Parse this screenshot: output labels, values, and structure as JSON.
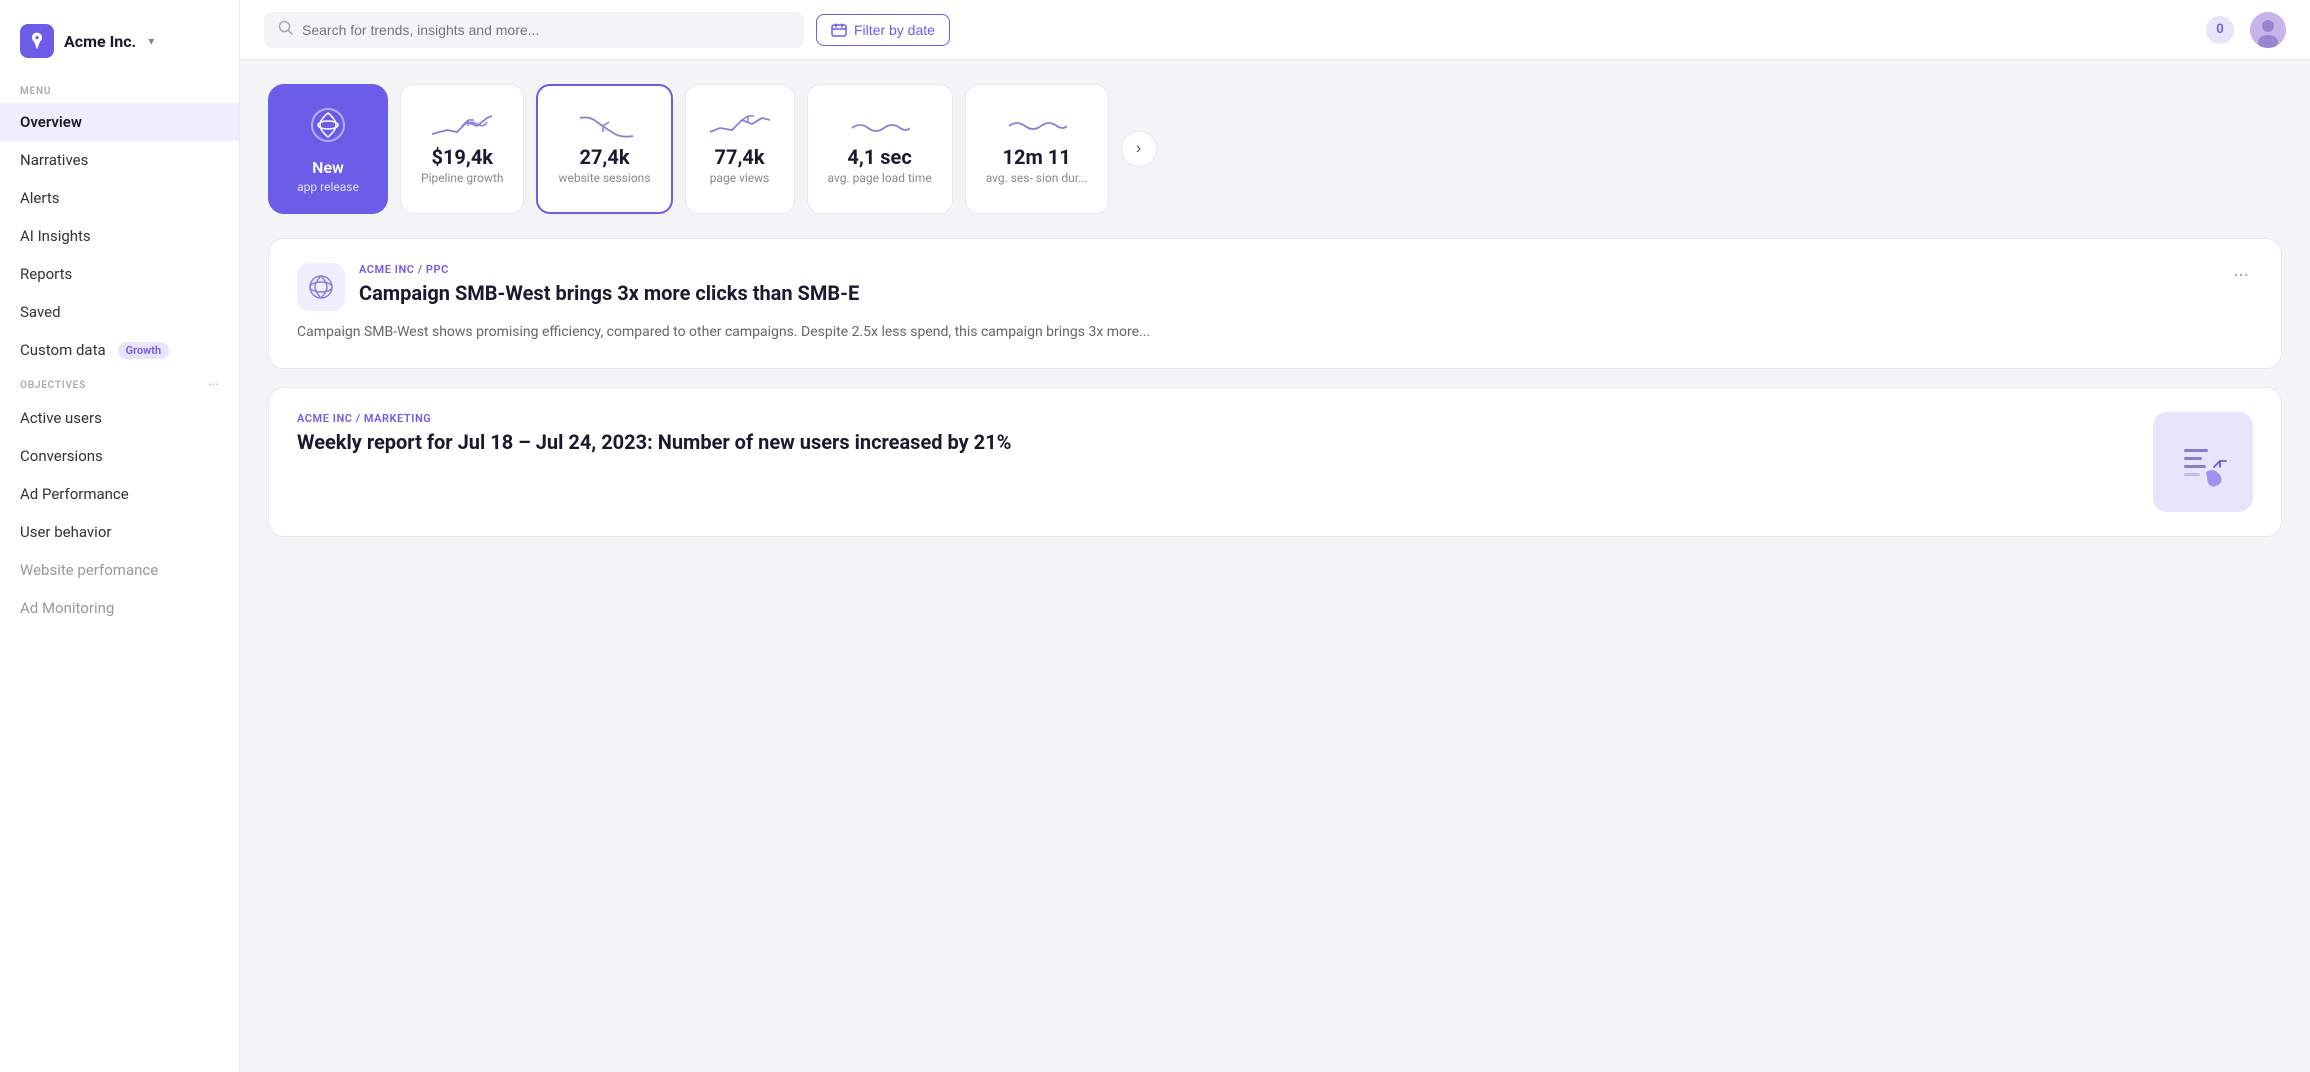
{
  "sidebar": {
    "company": "Acme Inc.",
    "menu_label": "MENU",
    "objectives_label": "OBJECTIVES",
    "nav_items": [
      {
        "id": "overview",
        "label": "Overview",
        "active": true
      },
      {
        "id": "narratives",
        "label": "Narratives",
        "active": false
      },
      {
        "id": "alerts",
        "label": "Alerts",
        "active": false
      },
      {
        "id": "ai-insights",
        "label": "AI Insights",
        "active": false
      },
      {
        "id": "reports",
        "label": "Reports",
        "active": false
      },
      {
        "id": "saved",
        "label": "Saved",
        "active": false
      },
      {
        "id": "custom-data",
        "label": "Custom data",
        "badge": "Growth",
        "active": false
      }
    ],
    "objectives": [
      {
        "id": "active-users",
        "label": "Active users",
        "muted": false
      },
      {
        "id": "conversions",
        "label": "Conversions",
        "muted": false
      },
      {
        "id": "ad-performance",
        "label": "Ad Performance",
        "muted": false
      },
      {
        "id": "user-behavior",
        "label": "User behavior",
        "muted": false
      },
      {
        "id": "website-performance",
        "label": "Website perfomance",
        "muted": true
      },
      {
        "id": "ad-monitoring",
        "label": "Ad Monitoring",
        "muted": true
      }
    ]
  },
  "topnav": {
    "search_placeholder": "Search for trends, insights and more...",
    "filter_label": "Filter by date",
    "notification_count": "0"
  },
  "metrics": [
    {
      "id": "new-app-release",
      "type": "featured",
      "value": "New",
      "label": "app release",
      "has_icon": true
    },
    {
      "id": "pipeline-growth",
      "type": "normal",
      "value": "$19,4k",
      "label": "Pipeline growth",
      "chart": "up"
    },
    {
      "id": "website-sessions",
      "type": "selected",
      "value": "27,4k",
      "label": "website sessions",
      "chart": "down"
    },
    {
      "id": "page-views",
      "type": "normal",
      "value": "77,4k",
      "label": "page views",
      "chart": "up"
    },
    {
      "id": "avg-page-load",
      "type": "normal",
      "value": "4,1 sec",
      "label": "avg. page load time",
      "chart": "wave"
    },
    {
      "id": "avg-session-dur",
      "type": "normal",
      "value": "12m 11",
      "label": "avg. ses- sion dur...",
      "chart": "wave2"
    }
  ],
  "next_button_label": "›",
  "insight_cards": [
    {
      "id": "ppc-card",
      "breadcrumb": "ACME INC / PPC",
      "title": "Campaign SMB-West brings  3x more clicks than SMB-E",
      "body": "Campaign SMB-West shows promising efficiency, compared to other campaigns. Despite 2.5x less spend, this campaign brings  3x more...",
      "has_icon": true
    },
    {
      "id": "marketing-card",
      "breadcrumb": "ACME INC / MARKETING",
      "title": "Weekly report for Jul 18 – Jul 24, 2023: Number of new users increased by 21%",
      "body": "",
      "has_img": true
    }
  ]
}
